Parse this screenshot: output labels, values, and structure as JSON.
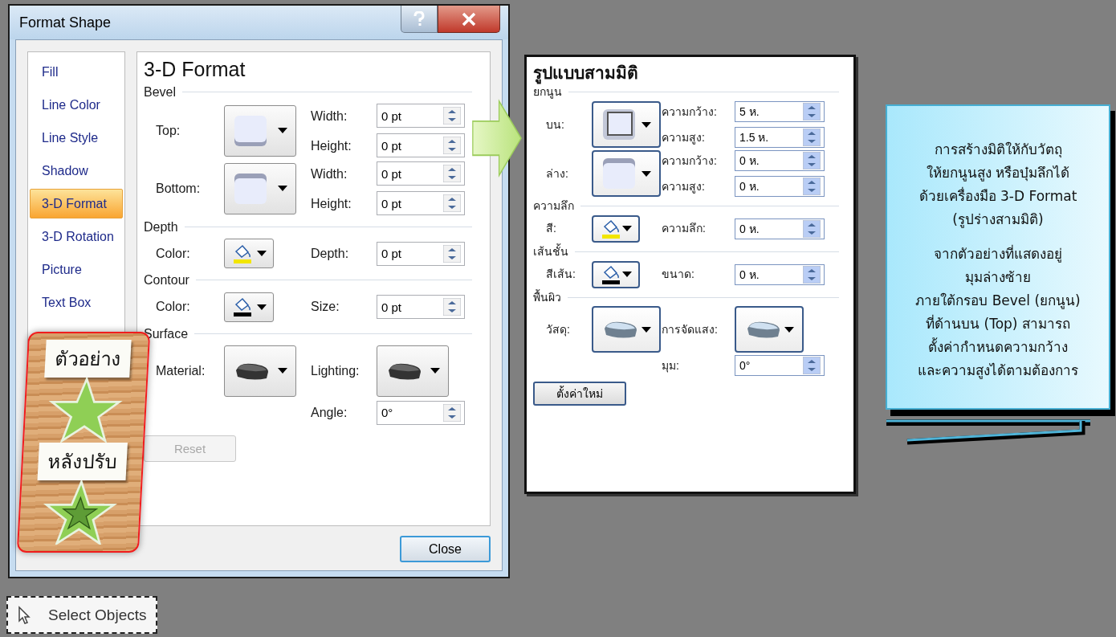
{
  "dialog": {
    "title": "Format Shape",
    "sidebar": {
      "items": [
        {
          "label": "Fill",
          "selected": false
        },
        {
          "label": "Line Color",
          "selected": false
        },
        {
          "label": "Line Style",
          "selected": false
        },
        {
          "label": "Shadow",
          "selected": false
        },
        {
          "label": "3-D Format",
          "selected": true
        },
        {
          "label": "3-D Rotation",
          "selected": false
        },
        {
          "label": "Picture",
          "selected": false
        },
        {
          "label": "Text Box",
          "selected": false
        }
      ]
    },
    "panel": {
      "kind": "win7",
      "heading": "3-D Format",
      "sections": [
        {
          "title": "Bevel",
          "rows": [
            {
              "left": {
                "label": "Top:",
                "kind": "bevel-raised"
              },
              "right": [
                {
                  "label": "Width:",
                  "kind": "spin",
                  "value": "0 pt"
                },
                {
                  "label": "Height:",
                  "kind": "spin",
                  "value": "0 pt"
                }
              ]
            },
            {
              "left": {
                "label": "Bottom:",
                "kind": "bevel-sunken"
              },
              "right": [
                {
                  "label": "Width:",
                  "kind": "spin",
                  "value": "0 pt"
                },
                {
                  "label": "Height:",
                  "kind": "spin",
                  "value": "0 pt"
                }
              ]
            }
          ]
        },
        {
          "title": "Depth",
          "rows": [
            {
              "left": {
                "label": "Color:",
                "kind": "color-picker",
                "color": "#f2e600"
              },
              "right": [
                {
                  "label": "Depth:",
                  "kind": "spin",
                  "value": "0 pt"
                }
              ]
            }
          ]
        },
        {
          "title": "Contour",
          "rows": [
            {
              "left": {
                "label": "Color:",
                "kind": "color-picker",
                "color": "#000000"
              },
              "right": [
                {
                  "label": "Size:",
                  "kind": "spin",
                  "value": "0 pt"
                }
              ]
            }
          ]
        },
        {
          "title": "Surface",
          "rows": [
            {
              "left": {
                "label": "Material:",
                "kind": "material"
              },
              "right": [
                {
                  "label": "Lighting:",
                  "kind": "material"
                }
              ]
            },
            {
              "right": [
                {
                  "label": "Angle:",
                  "kind": "spin",
                  "value": "0°"
                }
              ]
            }
          ]
        }
      ],
      "reset": {
        "label": "Reset",
        "disabled": true
      }
    },
    "close_button": "Close"
  },
  "sample_card": {
    "labels": [
      "ตัวอย่าง",
      "หลังปรับ"
    ]
  },
  "thai_panel": {
    "kind": "office",
    "heading": "รูปแบบสามมิติ",
    "sections": [
      {
        "title": "ยกนูน",
        "rows": [
          {
            "left": {
              "label": "บน:",
              "kind": "bevel-frame"
            },
            "right": [
              {
                "label": "ความกว้าง:",
                "kind": "spin",
                "value": "5 ห."
              },
              {
                "label": "ความสูง:",
                "kind": "spin",
                "value": "1.5 ห."
              }
            ]
          },
          {
            "left": {
              "label": "ล่าง:",
              "kind": "bevel-sunken"
            },
            "right": [
              {
                "label": "ความกว้าง:",
                "kind": "spin",
                "value": "0 ห."
              },
              {
                "label": "ความสูง:",
                "kind": "spin",
                "value": "0 ห."
              }
            ]
          }
        ]
      },
      {
        "title": "ความลึก",
        "rows": [
          {
            "left": {
              "label": "สี:",
              "kind": "color-picker",
              "color": "#f2e600"
            },
            "right": [
              {
                "label": "ความลึก:",
                "kind": "spin",
                "value": "0 ห."
              }
            ]
          }
        ]
      },
      {
        "title": "เส้นชั้น",
        "rows": [
          {
            "left": {
              "label": "สีเส้น:",
              "kind": "color-picker",
              "color": "#000000"
            },
            "right": [
              {
                "label": "ขนาด:",
                "kind": "spin",
                "value": "0 ห."
              }
            ]
          }
        ]
      },
      {
        "title": "พื้นผิว",
        "rows": [
          {
            "left": {
              "label": "วัสดุ:",
              "kind": "material"
            },
            "right": [
              {
                "label": "การจัดแสง:",
                "kind": "material"
              }
            ]
          },
          {
            "right": [
              {
                "label": "มุม:",
                "kind": "spin",
                "value": "0°"
              }
            ]
          }
        ]
      }
    ],
    "reset": {
      "label": "ตั้งค่าใหม่",
      "disabled": false
    }
  },
  "callout": {
    "paragraphs": [
      [
        "การสร้างมิติให้กับวัตถุ",
        "ให้ยกนูนสูง หรือบุ๋มลึกได้",
        "ด้วยเครื่องมือ 3-D Format",
        "(รูปร่างสามมิติ)"
      ],
      [
        "จากตัวอย่างที่แสดงอยู่",
        "มุมล่างซ้าย",
        "ภายใต้กรอบ Bevel (ยกนูน)",
        "ที่ด้านบน (Top) สามารถ",
        "ตั้งค่ากำหนดความกว้าง",
        "และความสูงได้ตามต้องการ"
      ]
    ]
  },
  "select_objects": {
    "label": "Select Objects"
  }
}
